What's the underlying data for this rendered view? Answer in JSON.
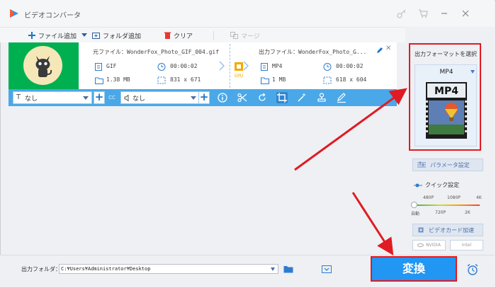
{
  "app": {
    "title": "ビデオコンバータ"
  },
  "toolbar": {
    "add_file": "ファイル追加",
    "add_folder": "フォルダ追加",
    "clear": "クリア",
    "merge": "マージ"
  },
  "file": {
    "source_label": "元ファイル：",
    "source_name": "WonderFox_Photo_GIF_004.gif",
    "source_format": "GIF",
    "source_duration": "00:00:02",
    "source_size": "1.38 MB",
    "source_resolution": "831 x 671",
    "output_label": "出力ファイル：",
    "output_name": "WonderFox_Photo_G...",
    "output_format": "MP4",
    "output_duration": "00:00:02",
    "output_size": "1 MB",
    "output_resolution": "618 x 604",
    "gpu_label": "GPU"
  },
  "editbar": {
    "subtitle_value": "なし",
    "audio_value": "なし",
    "cc_label": "CC"
  },
  "rightpanel": {
    "format_title": "出力フォーマットを選択",
    "format_name": "MP4",
    "format_icon_text": "MP4",
    "param_button": "パラメータ設定",
    "quick_label": "クイック設定",
    "ticks_top": [
      "480P",
      "1080P",
      "4K"
    ],
    "ticks_bottom": [
      "自動",
      "720P",
      "2K"
    ],
    "gpu_accel": "ビデオカード加速",
    "nvidia": "NVIDIA",
    "intel": "Intel"
  },
  "bottom": {
    "output_folder_label": "出力フォルダ：",
    "output_path": "C:¥Users¥Administrator¥Desktop",
    "convert_button": "変換"
  },
  "colors": {
    "accent": "#2196f3",
    "highlight": "#e01b24",
    "editbar": "#4aa8e8",
    "thumb_bg": "#00b050"
  }
}
